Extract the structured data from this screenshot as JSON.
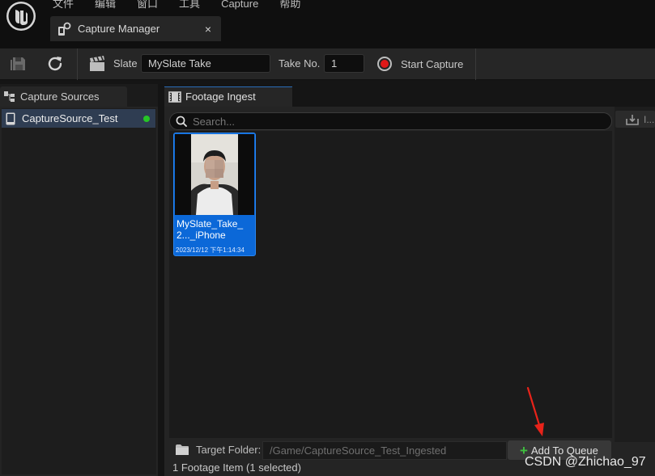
{
  "menu": {
    "items": [
      "文件",
      "编辑",
      "窗口",
      "工具",
      "Capture",
      "帮助"
    ]
  },
  "document_tab": {
    "label": "Capture Manager",
    "close_glyph": "×"
  },
  "toolbar": {
    "slate_label": "Slate",
    "slate_value": "MySlate Take",
    "take_label": "Take No.",
    "take_value": "1",
    "start_capture_label": "Start Capture",
    "icons": [
      "save-icon",
      "refresh-icon",
      "clapperboard-icon",
      "record-icon"
    ]
  },
  "capture_sources": {
    "tab_label": "Capture Sources",
    "items": [
      {
        "label": "CaptureSource_Test",
        "status": "connected",
        "status_color": "#26c526"
      }
    ]
  },
  "footage_ingest": {
    "tab_label": "Footage Ingest",
    "search_placeholder": "Search...",
    "import_label": "I...",
    "items": [
      {
        "name": "MySlate_Take_2..._iPhone",
        "date": "2023/12/12 下午1:14:34",
        "selected": true
      }
    ],
    "target_folder_label": "Target Folder:",
    "target_folder_value": "/Game/CaptureSource_Test_Ingested",
    "add_to_queue_label": "Add To Queue",
    "status": "1 Footage Item (1 selected)"
  },
  "colors": {
    "selection_blue": "#0b68d8",
    "record_red": "#e01818",
    "add_green": "#3fbf3f",
    "annotation_red": "#e8231a"
  },
  "watermark": "CSDN @Zhichao_97"
}
